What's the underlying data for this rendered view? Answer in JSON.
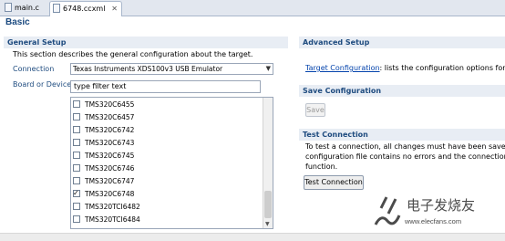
{
  "tabs": [
    {
      "label": "main.c",
      "icon": "c-file-icon"
    },
    {
      "label": "6748.ccxml",
      "icon": "config-file-icon",
      "close": "✕"
    }
  ],
  "page_title": "Basic",
  "general_setup": {
    "title": "General Setup",
    "description": "This section describes the general configuration about the target.",
    "connection_label": "Connection",
    "connection_value": "Texas Instruments XDS100v3 USB Emulator",
    "board_label": "Board or Device",
    "filter_value": "type filter text",
    "devices": [
      {
        "name": "TMS320C6455",
        "checked": false
      },
      {
        "name": "TMS320C6457",
        "checked": false
      },
      {
        "name": "TMS320C6742",
        "checked": false
      },
      {
        "name": "TMS320C6743",
        "checked": false
      },
      {
        "name": "TMS320C6745",
        "checked": false
      },
      {
        "name": "TMS320C6746",
        "checked": false
      },
      {
        "name": "TMS320C6747",
        "checked": false
      },
      {
        "name": "TMS320C6748",
        "checked": true
      },
      {
        "name": "TMS320TCI6482",
        "checked": false
      },
      {
        "name": "TMS320TCI6484",
        "checked": false
      }
    ]
  },
  "advanced_setup": {
    "title": "Advanced Setup",
    "link": "Target Configuration",
    "text": ": lists the configuration options for t"
  },
  "save_configuration": {
    "title": "Save Configuration",
    "button": "Save"
  },
  "test_connection": {
    "title": "Test Connection",
    "lines": [
      "To test a connection, all changes must have been saved, t",
      "configuration file contains no errors and the connection ty",
      "function."
    ],
    "button": "Test Connection"
  },
  "watermark": {
    "text": "电子发烧友",
    "url": "www.elecfans.com"
  },
  "colors": {
    "section_header_bg": "#e8edf4",
    "heading": "#1e4b7f",
    "link": "#0645ad"
  }
}
